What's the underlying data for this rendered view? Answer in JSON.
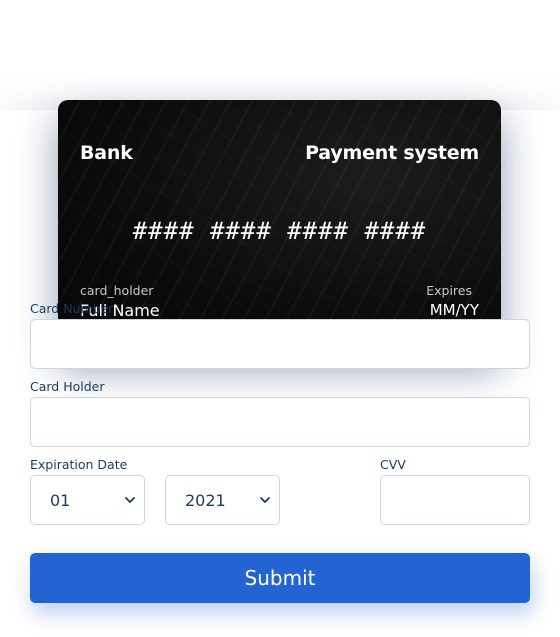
{
  "card": {
    "bank": "Bank",
    "payment_system": "Payment system",
    "number_mask": "#### #### #### ####",
    "holder_label": "card_holder",
    "holder_value": "Full Name",
    "expires_label": "Expires",
    "expires_value": "MM/YY"
  },
  "form": {
    "card_number_label": "Card Number",
    "card_number_value": "",
    "card_holder_label": "Card Holder",
    "card_holder_value": "",
    "expiration_label": "Expiration Date",
    "month_selected": "01",
    "year_selected": "2021",
    "cvv_label": "CVV",
    "cvv_value": "",
    "submit_label": "Submit"
  },
  "colors": {
    "accent": "#2364d2",
    "label_text": "#1a3b5d",
    "input_border": "#ced6e0",
    "card_background": "#0b0b0b"
  }
}
